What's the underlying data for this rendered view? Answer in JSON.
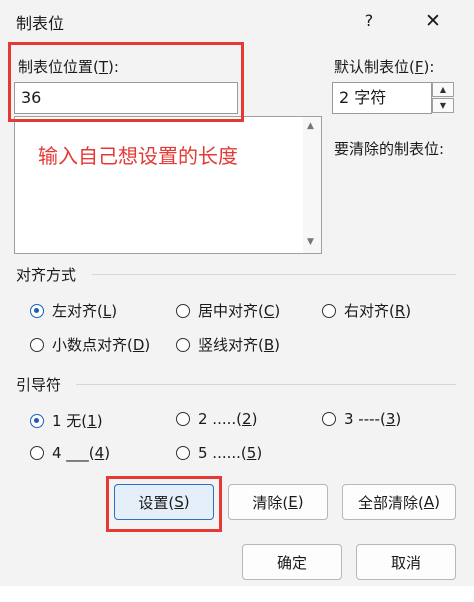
{
  "title": "制表位",
  "help": "?",
  "close": "✕",
  "tab_position": {
    "label_prefix": "制表位位置(",
    "label_key": "T",
    "label_suffix": "):",
    "value": "36"
  },
  "default_tab": {
    "label_prefix": "默认制表位(",
    "label_key": "F",
    "label_suffix": "):",
    "value": "2 字符"
  },
  "clear_label": "要清除的制表位:",
  "annotation": "输入自己想设置的长度",
  "alignment": {
    "title": "对齐方式",
    "options": [
      {
        "prefix": "左对齐(",
        "key": "L",
        "suffix": ")",
        "selected": true
      },
      {
        "prefix": "居中对齐(",
        "key": "C",
        "suffix": ")",
        "selected": false
      },
      {
        "prefix": "右对齐(",
        "key": "R",
        "suffix": ")",
        "selected": false
      },
      {
        "prefix": "小数点对齐(",
        "key": "D",
        "suffix": ")",
        "selected": false
      },
      {
        "prefix": "竖线对齐(",
        "key": "B",
        "suffix": ")",
        "selected": false
      }
    ]
  },
  "leader": {
    "title": "引导符",
    "options": [
      {
        "prefix": "1 无(",
        "key": "1",
        "suffix": ")",
        "selected": true
      },
      {
        "prefix": "2 .....(",
        "key": "2",
        "suffix": ")",
        "selected": false
      },
      {
        "prefix": "3 ----(",
        "key": "3",
        "suffix": ")",
        "selected": false
      },
      {
        "prefix": "4 ___(",
        "key": "4",
        "suffix": ")",
        "selected": false
      },
      {
        "prefix": "5 ......(",
        "key": "5",
        "suffix": ")",
        "selected": false
      }
    ]
  },
  "buttons": {
    "set": {
      "prefix": "设置(",
      "key": "S",
      "suffix": ")"
    },
    "clear": {
      "prefix": "清除(",
      "key": "E",
      "suffix": ")"
    },
    "clear_all": {
      "prefix": "全部清除(",
      "key": "A",
      "suffix": ")"
    },
    "ok": "确定",
    "cancel": "取消"
  },
  "colors": {
    "annotation_red": "#e53935",
    "accent_blue": "#1a5fb4"
  }
}
